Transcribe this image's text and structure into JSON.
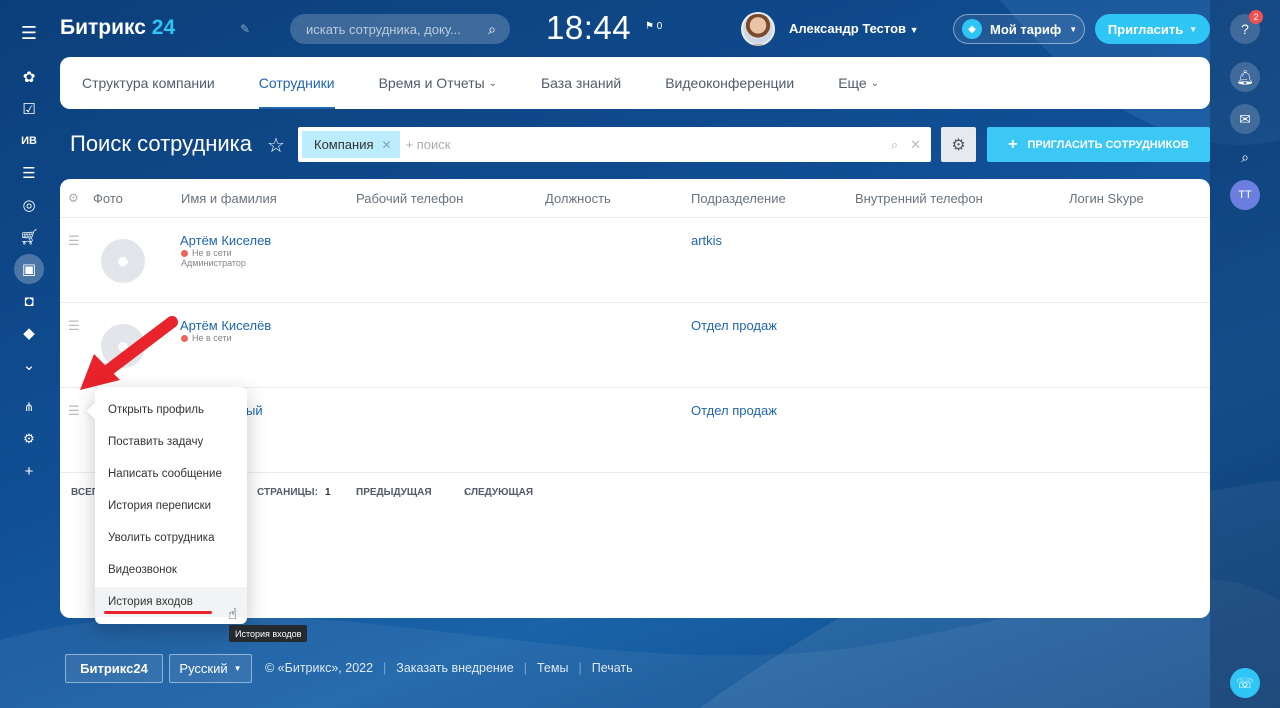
{
  "header": {
    "logo_text": "Битрикс",
    "logo_num": "24",
    "search_placeholder": "искать сотрудника, доку...",
    "clock": "18:44",
    "flag_count": "0",
    "user_name": "Александр Тестов",
    "tariff_label": "Мой тариф",
    "invite_label": "Пригласить"
  },
  "left_sidebar": {
    "items": [
      "feed-icon",
      "tasks-icon",
      "ИВ",
      "filter-icon",
      "target-icon",
      "cart-icon",
      "contacts-icon",
      "robot-icon",
      "box-icon",
      "more-icon",
      "sitemap-icon",
      "gear-icon",
      "plus-icon"
    ]
  },
  "right_sidebar": {
    "help_badge": "2",
    "avatar_initials": "ТТ"
  },
  "nav": {
    "tabs": [
      "Структура компании",
      "Сотрудники",
      "Время и Отчеты",
      "База знаний",
      "Видеоконференции",
      "Еще"
    ],
    "active_tab": "Сотрудники"
  },
  "page": {
    "title": "Поиск сотрудника",
    "filter_tag": "Компания",
    "filter_placeholder": "+ поиск",
    "invite_employees": "ПРИГЛАСИТЬ СОТРУДНИКОВ"
  },
  "table": {
    "columns": [
      "Фото",
      "Имя и фамилия",
      "Рабочий телефон",
      "Должность",
      "Подразделение",
      "Внутренний телефон",
      "Логин Skype"
    ],
    "rows": [
      {
        "name": "Артём Киселев",
        "status": "Не в сети",
        "role": "Администратор",
        "department": "artkis"
      },
      {
        "name": "Артём Киселёв",
        "status": "Не в сети",
        "role": "",
        "department": "Отдел продаж"
      },
      {
        "name": "ый",
        "status": "",
        "role": "",
        "department": "Отдел продаж"
      }
    ],
    "pager": {
      "total_label": "ВСЕГ",
      "pages_label": "СТРАНИЦЫ:",
      "page_num": "1",
      "prev": "ПРЕДЫДУЩАЯ",
      "next": "СЛЕДУЮЩАЯ"
    }
  },
  "context_menu": {
    "items": [
      "Открыть профиль",
      "Поставить задачу",
      "Написать сообщение",
      "История переписки",
      "Уволить сотрудника",
      "Видеозвонок",
      "История входов"
    ],
    "hovered": "История входов",
    "tooltip": "История входов"
  },
  "footer": {
    "logo": "Битрикс24",
    "language": "Русский",
    "copyright": "© «Битрикс», 2022",
    "links": [
      "Заказать внедрение",
      "Темы",
      "Печать"
    ]
  },
  "colors": {
    "accent": "#2fc6f6",
    "link": "#2066b0",
    "annotation_red": "#e8232b"
  }
}
